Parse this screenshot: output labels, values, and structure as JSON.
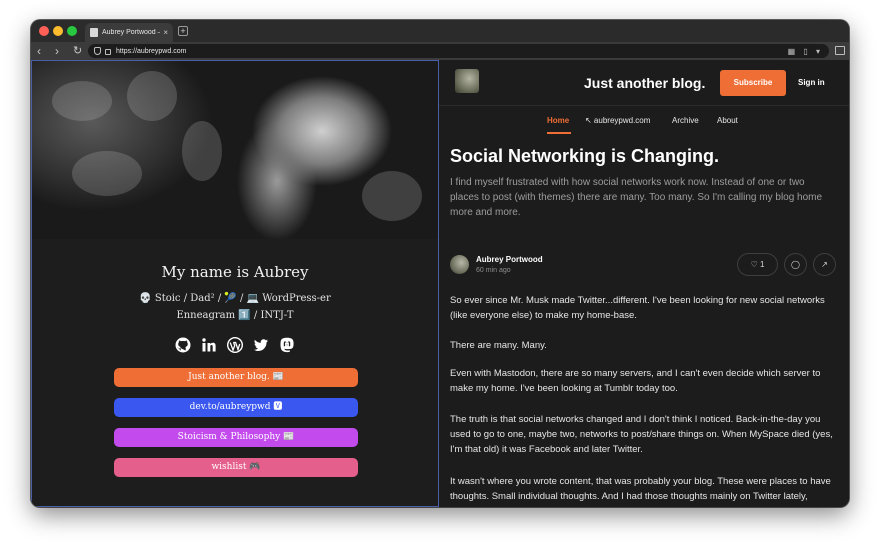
{
  "browser": {
    "tab_title": "Aubrey Portwood — @",
    "tab_close": "×",
    "new_tab": "+",
    "back": "‹",
    "forward": "›",
    "reload": "↻",
    "url": "https://aubreypwd.com",
    "url_right_icons": "▦ ▯ ▾"
  },
  "profile": {
    "name": "My name is Aubrey",
    "bio_line1": "💀 Stoic / Dad² / 🎾 / 💻 WordPress-er",
    "bio_line2": "Enneagram 1️⃣ / INTJ-T",
    "socials": [
      "github-icon",
      "linkedin-icon",
      "wordpress-icon",
      "twitter-icon",
      "mastodon-icon"
    ],
    "links": [
      {
        "label": "Just another blog. 📰",
        "color": "#ee6e36"
      },
      {
        "label": "dev.to/aubreypwd 🆅",
        "color": "#3a57f0"
      },
      {
        "label": "Stoicism & Philosophy 📰",
        "color": "#c34bee"
      },
      {
        "label": "wishlist 🎮",
        "color": "#e55f8c"
      }
    ]
  },
  "blog": {
    "site_title": "Just another blog.",
    "subscribe": "Subscribe",
    "sign_in": "Sign in",
    "nav": [
      "Home",
      "↖ aubreypwd.com",
      "Archive",
      "About"
    ],
    "accent": "#ee6e36",
    "post": {
      "title": "Social Networking is Changing.",
      "excerpt": "I find myself frustrated with how social networks work now. Instead of one or two places to post (with themes) there are many. Too many. So I'm calling my blog home more and more.",
      "author": "Aubrey Portwood",
      "time": "60 min ago",
      "likes": "♡ 1",
      "comment_icon": "◯",
      "share_icon": "↗",
      "paragraphs": [
        "So ever since Mr. Musk made Twitter...different. I've been looking for new social networks (like everyone else) to make my home-base.",
        "There are many. Many.",
        "Even with Mastodon, there are so many servers, and I can't even decide which server to make my home. I've been looking at Tumblr today too.",
        "The truth is that social networks changed and I don't think I noticed. Back-in-the-day you used to go to one, maybe two, networks to post/share things on. When MySpace died (yes, I'm that old) it was Facebook and later Twitter.",
        "It wasn't where you wrote content, that was probably your blog. These were places to have thoughts. Small individual thoughts. And I had those thoughts mainly on Twitter lately, because that's where most of my like-minded people were. I rarely"
      ]
    }
  }
}
